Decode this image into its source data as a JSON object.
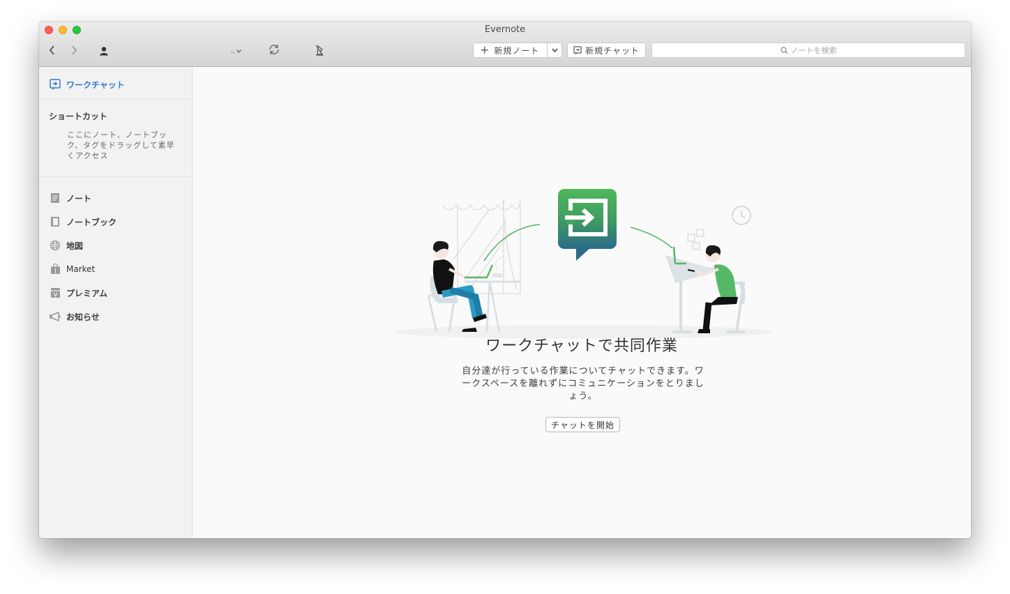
{
  "window": {
    "title": "Evernote"
  },
  "toolbar": {
    "more_label": "..",
    "new_note_label": "新規ノート",
    "new_chat_label": "新規チャット",
    "search_placeholder": "ノートを検索"
  },
  "sidebar": {
    "work_chat": "ワークチャット",
    "shortcuts": {
      "title": "ショートカット",
      "hint": "ここにノート、ノートブック、タグをドラッグして素早くアクセス"
    },
    "items": [
      {
        "label": "ノート",
        "icon": "note-icon"
      },
      {
        "label": "ノートブック",
        "icon": "notebook-icon"
      },
      {
        "label": "地図",
        "icon": "globe-icon"
      },
      {
        "label": "Market",
        "icon": "market-icon"
      },
      {
        "label": "プレミアム",
        "icon": "premium-icon"
      },
      {
        "label": "お知らせ",
        "icon": "megaphone-icon"
      }
    ]
  },
  "main": {
    "headline": "ワークチャットで共同作業",
    "description": "自分達が行っている作業についてチャットできます。ワークスペースを離れずにコミュニケーションをとりましょう。",
    "start_button": "チャットを開始"
  },
  "colors": {
    "accent_blue": "#2d7bd0",
    "evernote_green": "#3bb44a",
    "chat_gradient_bottom": "#2b6a8a"
  }
}
